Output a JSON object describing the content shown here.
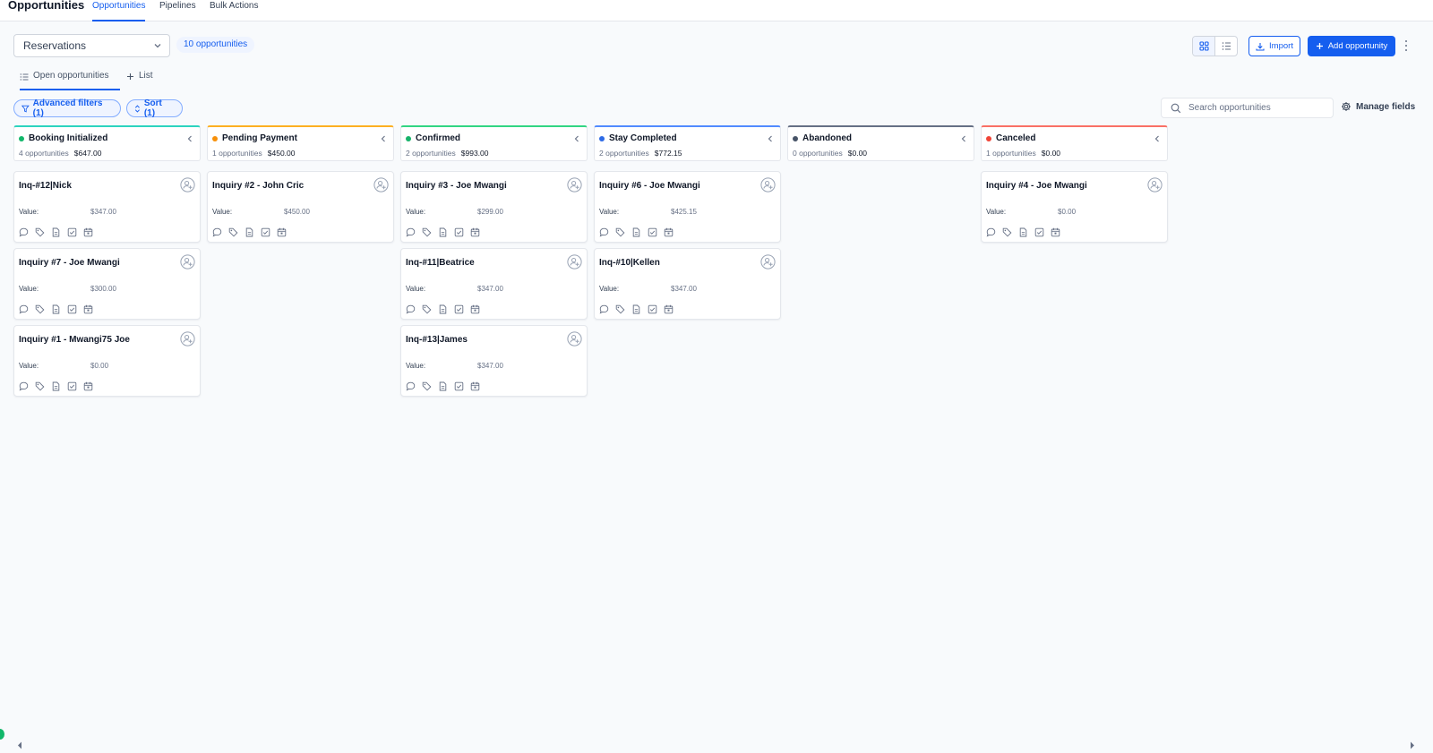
{
  "header": {
    "title": "Opportunities",
    "tabs": [
      {
        "label": "Opportunities",
        "active": true
      },
      {
        "label": "Pipelines",
        "active": false
      },
      {
        "label": "Bulk Actions",
        "active": false
      }
    ]
  },
  "toolbar": {
    "pipeline_select": "Reservations",
    "count_badge": "10 opportunities",
    "import_label": "Import",
    "add_label": "Add opportunity",
    "views": [
      "grid-icon",
      "list-icon"
    ]
  },
  "subtabs": [
    {
      "label": "Open opportunities",
      "icon": "list-icon",
      "active": true
    },
    {
      "label": "List",
      "icon": "plus-icon",
      "active": false
    }
  ],
  "filters": {
    "advanced_label": "Advanced filters (1)",
    "sort_label": "Sort (1)",
    "search_placeholder": "Search opportunities",
    "manage_label": "Manage fields"
  },
  "colors": {
    "accent": "#155eef",
    "booking_initialized": "#12b76a",
    "pending_payment": "#f79009",
    "confirmed": "#17b26a",
    "stay_completed": "#2e6be6",
    "abandoned": "#475467",
    "canceled": "#f04438"
  },
  "columns": [
    {
      "name": "Booking Initialized",
      "color": "#2dd4bf",
      "dot": "#12b76a",
      "count": "4 opportunities",
      "total": "$647.00",
      "cards": [
        {
          "title": "Inq-#12|Nick",
          "value_label": "Value:",
          "value": "$347.00"
        },
        {
          "title": "Inquiry #7 - Joe Mwangi",
          "value_label": "Value:",
          "value": "$300.00"
        },
        {
          "title": "Inquiry #1 - Mwangi75 Joe",
          "value_label": "Value:",
          "value": "$0.00"
        }
      ]
    },
    {
      "name": "Pending Payment",
      "color": "#fdb022",
      "dot": "#f79009",
      "count": "1 opportunities",
      "total": "$450.00",
      "cards": [
        {
          "title": "Inquiry #2 - John Cric",
          "value_label": "Value:",
          "value": "$450.00"
        }
      ]
    },
    {
      "name": "Confirmed",
      "color": "#32d583",
      "dot": "#17b26a",
      "count": "2 opportunities",
      "total": "$993.00",
      "cards": [
        {
          "title": "Inquiry #3 - Joe Mwangi",
          "value_label": "Value:",
          "value": "$299.00"
        },
        {
          "title": "Inq-#11|Beatrice",
          "value_label": "Value:",
          "value": "$347.00"
        },
        {
          "title": "Inq-#13|James",
          "value_label": "Value:",
          "value": "$347.00"
        }
      ]
    },
    {
      "name": "Stay Completed",
      "color": "#528bff",
      "dot": "#2e6be6",
      "count": "2 opportunities",
      "total": "$772.15",
      "cards": [
        {
          "title": "Inquiry #6 - Joe Mwangi",
          "value_label": "Value:",
          "value": "$425.15"
        },
        {
          "title": "Inq-#10|Kellen",
          "value_label": "Value:",
          "value": "$347.00"
        }
      ]
    },
    {
      "name": "Abandoned",
      "color": "#667085",
      "dot": "#475467",
      "count": "0 opportunities",
      "total": "$0.00",
      "cards": []
    },
    {
      "name": "Canceled",
      "color": "#f97066",
      "dot": "#f04438",
      "count": "1 opportunities",
      "total": "$0.00",
      "cards": [
        {
          "title": "Inquiry #4 - Joe Mwangi",
          "value_label": "Value:",
          "value": "$0.00"
        }
      ]
    }
  ],
  "card_action_icons": [
    "chat-icon",
    "tag-icon",
    "document-icon",
    "task-icon",
    "calendar-icon"
  ]
}
